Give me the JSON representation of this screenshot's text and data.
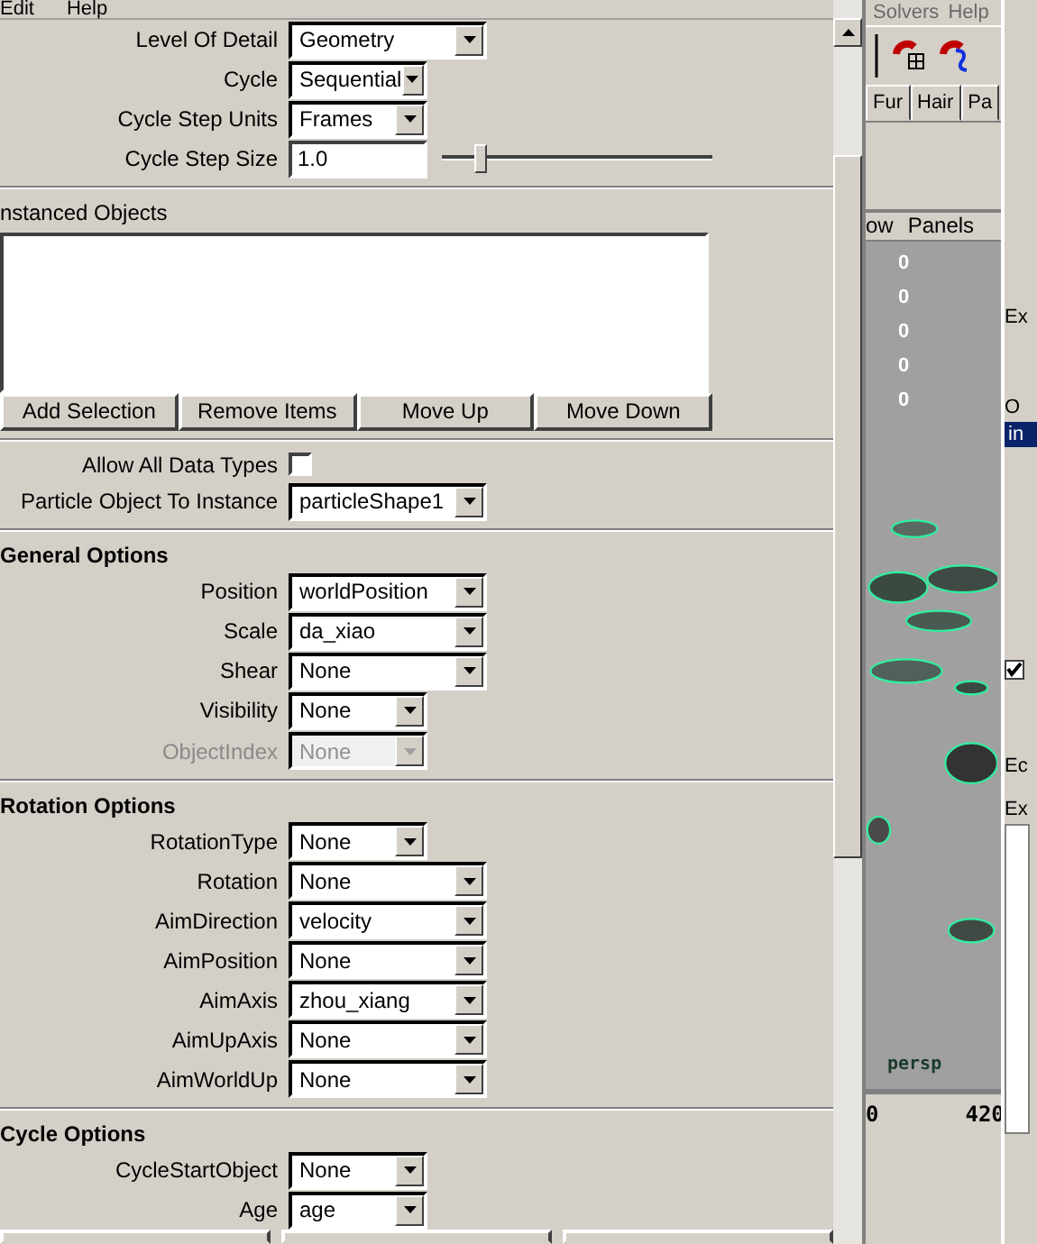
{
  "menu_bar": [
    "Edit",
    "Help"
  ],
  "top_fields": [
    {
      "label": "Level Of Detail",
      "kind": "wide",
      "value": "Geometry",
      "disabled": false
    },
    {
      "label": "Cycle",
      "kind": "narrow",
      "value": "Sequential",
      "disabled": false
    },
    {
      "label": "Cycle Step Units",
      "kind": "narrow",
      "value": "Frames",
      "disabled": false
    },
    {
      "label": "Cycle Step Size",
      "kind": "slider",
      "value": "1.0",
      "level": 0.12
    }
  ],
  "instanced_objects": {
    "title": "nstanced Objects",
    "buttons": [
      "Add Selection",
      "Remove Items",
      "Move Up",
      "Move Down"
    ]
  },
  "allow_all_data_types": {
    "label": "Allow All Data Types",
    "checked": false
  },
  "particle_object": {
    "label": "Particle Object To Instance",
    "kind": "wide",
    "value": "particleShape1",
    "disabled": false
  },
  "sections": [
    {
      "title": "General Options",
      "fields": [
        {
          "label": "Position",
          "kind": "wide",
          "value": "worldPosition",
          "disabled": false
        },
        {
          "label": "Scale",
          "kind": "wide",
          "value": "da_xiao",
          "disabled": false
        },
        {
          "label": "Shear",
          "kind": "wide",
          "value": "None",
          "disabled": false
        },
        {
          "label": "Visibility",
          "kind": "narrow",
          "value": "None",
          "disabled": false
        },
        {
          "label": "ObjectIndex",
          "kind": "narrow",
          "value": "None",
          "disabled": true
        }
      ]
    },
    {
      "title": "Rotation Options",
      "fields": [
        {
          "label": "RotationType",
          "kind": "narrow",
          "value": "None",
          "disabled": false
        },
        {
          "label": "Rotation",
          "kind": "wide",
          "value": "None",
          "disabled": false
        },
        {
          "label": "AimDirection",
          "kind": "wide",
          "value": "velocity",
          "disabled": false
        },
        {
          "label": "AimPosition",
          "kind": "wide",
          "value": "None",
          "disabled": false
        },
        {
          "label": "AimAxis",
          "kind": "wide",
          "value": "zhou_xiang",
          "disabled": false
        },
        {
          "label": "AimUpAxis",
          "kind": "wide",
          "value": "None",
          "disabled": false
        },
        {
          "label": "AimWorldUp",
          "kind": "wide",
          "value": "None",
          "disabled": false
        }
      ]
    },
    {
      "title": "Cycle Options",
      "fields": [
        {
          "label": "CycleStartObject",
          "kind": "narrow",
          "value": "None",
          "disabled": false
        },
        {
          "label": "Age",
          "kind": "narrow",
          "value": "age",
          "disabled": false
        }
      ]
    }
  ],
  "main_window": {
    "menu": [
      "Solvers",
      "Help"
    ],
    "shelf_tabs": [
      {
        "label": "Fur",
        "selected": false
      },
      {
        "label": "Hair",
        "selected": false
      },
      {
        "label": "Pa",
        "selected": false
      }
    ],
    "viewport": {
      "menu": [
        "ow",
        "Panels"
      ],
      "hud": [
        "0",
        "0",
        "0",
        "0",
        "0"
      ],
      "camera": "persp"
    },
    "timeline": [
      "0",
      "420"
    ]
  },
  "side_panel": {
    "label_1": "Ex",
    "label_2": "O",
    "list_item": {
      "label": "in",
      "selected": true
    },
    "checkbox": {
      "checked": true
    },
    "label_3": "Ec",
    "label_4": "Ex"
  }
}
